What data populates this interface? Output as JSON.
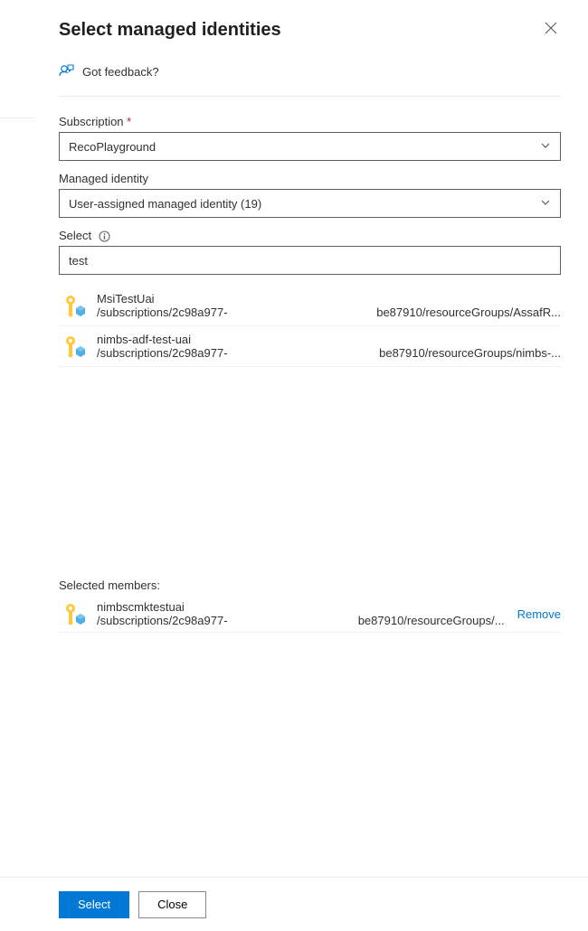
{
  "header": {
    "title": "Select managed identities"
  },
  "feedback": {
    "label": "Got feedback?"
  },
  "subscription": {
    "label": "Subscription",
    "value": "RecoPlayground"
  },
  "managed_identity": {
    "label": "Managed identity",
    "value": "User-assigned managed identity (19)"
  },
  "select_field": {
    "label": "Select",
    "value": "test"
  },
  "results": [
    {
      "name": "MsiTestUai",
      "path_left": "/subscriptions/2c98a977-",
      "path_right": "be87910/resourceGroups/AssafR..."
    },
    {
      "name": "nimbs-adf-test-uai",
      "path_left": "/subscriptions/2c98a977-",
      "path_right": "be87910/resourceGroups/nimbs-..."
    }
  ],
  "selected": {
    "heading": "Selected members:",
    "items": [
      {
        "name": "nimbscmktestuai",
        "path_left": "/subscriptions/2c98a977-",
        "path_right": "be87910/resourceGroups/...",
        "remove_label": "Remove"
      }
    ]
  },
  "footer": {
    "select_label": "Select",
    "close_label": "Close"
  }
}
